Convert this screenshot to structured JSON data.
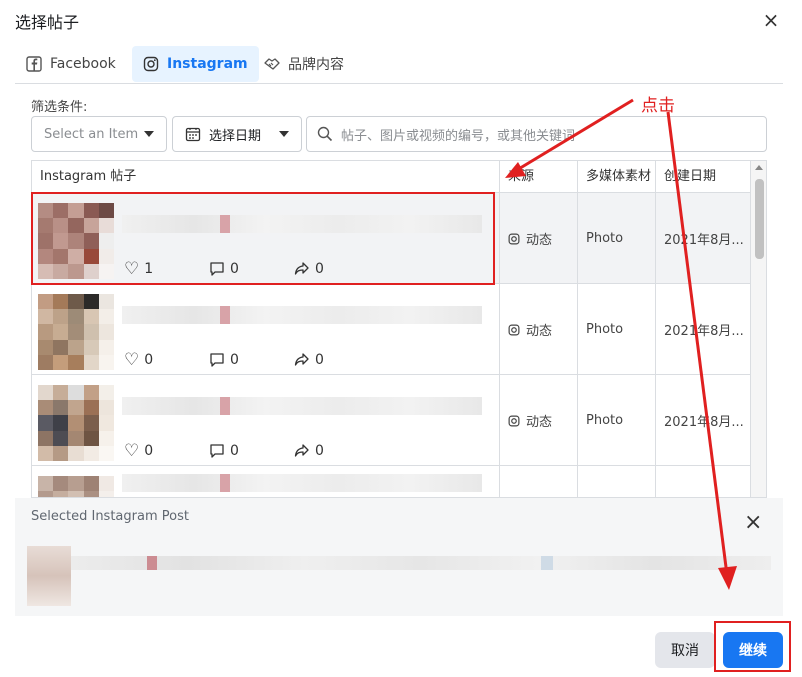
{
  "dialog": {
    "title": "选择帖子",
    "close_icon": "×"
  },
  "tabs": [
    {
      "label": "Facebook",
      "icon": "facebook-icon"
    },
    {
      "label": "Instagram",
      "icon": "instagram-icon"
    },
    {
      "label": "品牌内容",
      "icon": "handshake-icon"
    }
  ],
  "filter": {
    "label": "筛选条件:",
    "item_select_placeholder": "Select an Item",
    "date_select_label": "选择日期",
    "search_placeholder": "帖子、图片或视频的编号，或其他关键词"
  },
  "table": {
    "headers": {
      "post": "Instagram 帖子",
      "source": "来源",
      "media": "多媒体素材",
      "date": "创建日期"
    },
    "rows": [
      {
        "likes": "1",
        "comments": "0",
        "shares": "0",
        "source": "动态",
        "media": "Photo",
        "date": "2021年8月..."
      },
      {
        "likes": "0",
        "comments": "0",
        "shares": "0",
        "source": "动态",
        "media": "Photo",
        "date": "2021年8月..."
      },
      {
        "likes": "0",
        "comments": "0",
        "shares": "0",
        "source": "动态",
        "media": "Photo",
        "date": "2021年8月..."
      }
    ]
  },
  "selected": {
    "label": "Selected Instagram Post",
    "close_icon": "×"
  },
  "footer": {
    "cancel_label": "取消",
    "continue_label": "继续"
  },
  "annotation": {
    "text": "点击"
  },
  "colors": {
    "accent": "#1877f2",
    "annotation_red": "#e02020"
  }
}
